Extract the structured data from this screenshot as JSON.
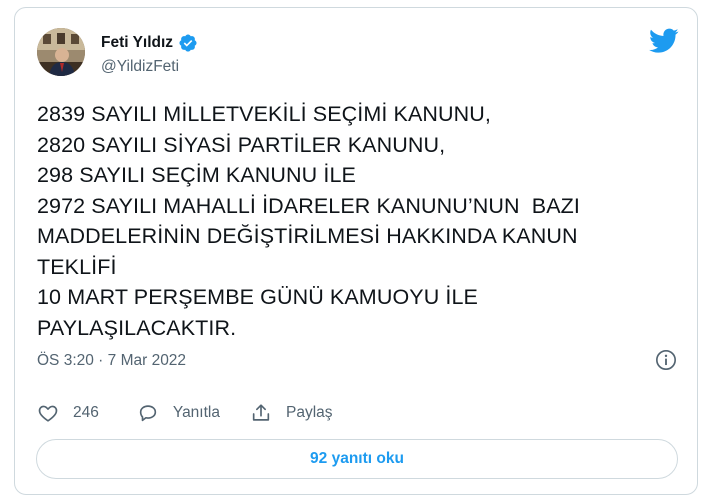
{
  "author": {
    "display_name": "Feti Yıldız",
    "handle": "@YildizFeti",
    "verified": true
  },
  "tweet": {
    "lines": [
      "2839 SAYILI MİLLETVEKİLİ SEÇİMİ KANUNU,",
      "2820 SAYILI SİYASİ PARTİLER KANUNU,",
      "298 SAYILI SEÇİM KANUNU İLE",
      "2972 SAYILI MAHALLİ İDARELER KANUNU’NUN  BAZI",
      "MADDELERİNİN DEĞİŞTİRİLMESİ HAKKINDA KANUN",
      "TEKLİFİ",
      "10 MART PERŞEMBE GÜNÜ KAMUOYU İLE",
      "PAYLAŞILACAKTIR."
    ],
    "timestamp": "ÖS 3:20 · 7 Mar 2022"
  },
  "actions": {
    "like_count": "246",
    "reply_label": "Yanıtla",
    "share_label": "Paylaş"
  },
  "read_replies_label": "92 yanıtı oku",
  "icons": {
    "brand": "twitter-bird-icon",
    "verified": "verified-badge-icon",
    "info": "info-icon",
    "like": "heart-icon",
    "reply": "speech-bubble-icon",
    "share": "share-icon"
  },
  "colors": {
    "brand_blue": "#1d9bf0",
    "text": "#0f1419",
    "muted": "#536471",
    "border": "#cfd9de"
  }
}
